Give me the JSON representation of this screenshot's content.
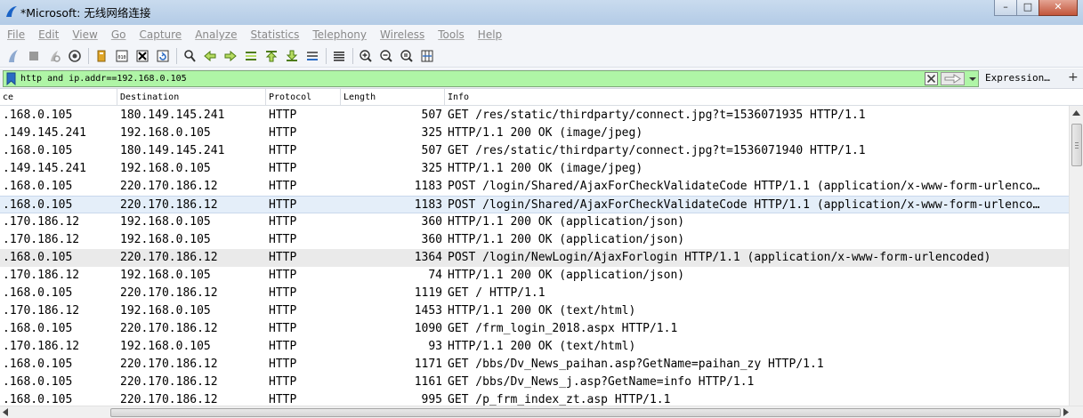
{
  "window": {
    "title": "*Microsoft: 无线网络连接",
    "controls": [
      "minimize",
      "maximize",
      "close"
    ]
  },
  "menu": {
    "items": [
      "File",
      "Edit",
      "View",
      "Go",
      "Capture",
      "Analyze",
      "Statistics",
      "Telephony",
      "Wireless",
      "Tools",
      "Help"
    ]
  },
  "toolbar": {
    "icons": [
      "shark-fin-start-icon",
      "stop-capture-icon",
      "restart-capture-icon",
      "capture-options-icon",
      "open-file-icon",
      "save-file-icon",
      "close-file-icon",
      "reload-file-icon",
      "find-packet-icon",
      "go-back-icon",
      "go-forward-icon",
      "go-to-packet-icon",
      "go-first-icon",
      "go-last-icon",
      "auto-scroll-icon",
      "colorize-icon",
      "zoom-in-icon",
      "zoom-out-icon",
      "zoom-normal-icon",
      "resize-columns-icon"
    ]
  },
  "filter": {
    "value": "http and ip.addr==192.168.0.105",
    "background": "#aff5a6",
    "expression_label": "Expression…",
    "add_label": "+"
  },
  "columns": [
    "ce",
    "Destination",
    "Protocol",
    "Length",
    "Info"
  ],
  "packets": [
    {
      "src": ".168.0.105",
      "dst": "180.149.145.241",
      "proto": "HTTP",
      "len": "507",
      "info": "GET /res/static/thirdparty/connect.jpg?t=1536071935 HTTP/1.1"
    },
    {
      "src": ".149.145.241",
      "dst": "192.168.0.105",
      "proto": "HTTP",
      "len": "325",
      "info": "HTTP/1.1 200 OK  (image/jpeg)"
    },
    {
      "src": ".168.0.105",
      "dst": "180.149.145.241",
      "proto": "HTTP",
      "len": "507",
      "info": "GET /res/static/thirdparty/connect.jpg?t=1536071940 HTTP/1.1"
    },
    {
      "src": ".149.145.241",
      "dst": "192.168.0.105",
      "proto": "HTTP",
      "len": "325",
      "info": "HTTP/1.1 200 OK  (image/jpeg)"
    },
    {
      "src": ".168.0.105",
      "dst": "220.170.186.12",
      "proto": "HTTP",
      "len": "1183",
      "info": "POST /login/Shared/AjaxForCheckValidateCode HTTP/1.1  (application/x-www-form-urlenco…"
    },
    {
      "src": ".168.0.105",
      "dst": "220.170.186.12",
      "proto": "HTTP",
      "len": "1183",
      "info": "POST /login/Shared/AjaxForCheckValidateCode HTTP/1.1  (application/x-www-form-urlenco…",
      "state": "selected"
    },
    {
      "src": ".170.186.12",
      "dst": "192.168.0.105",
      "proto": "HTTP",
      "len": "360",
      "info": "HTTP/1.1 200 OK  (application/json)"
    },
    {
      "src": ".170.186.12",
      "dst": "192.168.0.105",
      "proto": "HTTP",
      "len": "360",
      "info": "HTTP/1.1 200 OK  (application/json)"
    },
    {
      "src": ".168.0.105",
      "dst": "220.170.186.12",
      "proto": "HTTP",
      "len": "1364",
      "info": "POST /login/NewLogin/AjaxForlogin HTTP/1.1  (application/x-www-form-urlencoded)",
      "state": "hover"
    },
    {
      "src": ".170.186.12",
      "dst": "192.168.0.105",
      "proto": "HTTP",
      "len": "74",
      "info": "HTTP/1.1 200 OK  (application/json)"
    },
    {
      "src": ".168.0.105",
      "dst": "220.170.186.12",
      "proto": "HTTP",
      "len": "1119",
      "info": "GET / HTTP/1.1"
    },
    {
      "src": ".170.186.12",
      "dst": "192.168.0.105",
      "proto": "HTTP",
      "len": "1453",
      "info": "HTTP/1.1 200 OK  (text/html)"
    },
    {
      "src": ".168.0.105",
      "dst": "220.170.186.12",
      "proto": "HTTP",
      "len": "1090",
      "info": "GET /frm_login_2018.aspx HTTP/1.1"
    },
    {
      "src": ".170.186.12",
      "dst": "192.168.0.105",
      "proto": "HTTP",
      "len": "93",
      "info": "HTTP/1.1 200 OK  (text/html)"
    },
    {
      "src": ".168.0.105",
      "dst": "220.170.186.12",
      "proto": "HTTP",
      "len": "1171",
      "info": "GET /bbs/Dv_News_paihan.asp?GetName=paihan_zy HTTP/1.1"
    },
    {
      "src": ".168.0.105",
      "dst": "220.170.186.12",
      "proto": "HTTP",
      "len": "1161",
      "info": "GET /bbs/Dv_News_j.asp?GetName=info HTTP/1.1"
    },
    {
      "src": ".168.0.105",
      "dst": "220.170.186.12",
      "proto": "HTTP",
      "len": "995",
      "info": "GET /p_frm_index_zt.asp HTTP/1.1"
    }
  ]
}
